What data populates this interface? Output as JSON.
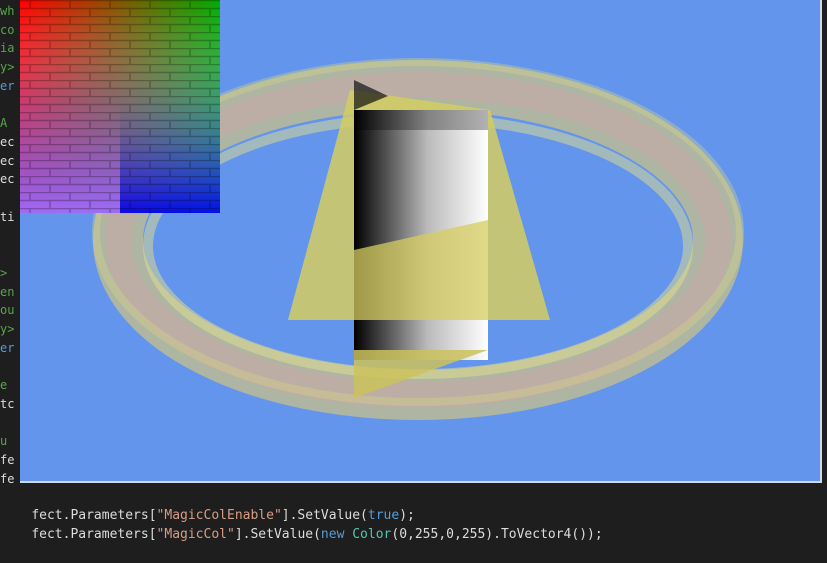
{
  "gutter": {
    "fragments": [
      {
        "text": "wh",
        "color": "#57a64a"
      },
      {
        "text": "co",
        "color": "#57a64a"
      },
      {
        "text": "ia",
        "color": "#57a64a"
      },
      {
        "text": "y>",
        "color": "#57a64a"
      },
      {
        "text": "er",
        "color": "#569cd6"
      },
      {
        "text": "",
        "color": "#dcdcdc"
      },
      {
        "text": " A",
        "color": "#57a64a"
      },
      {
        "text": "ec",
        "color": "#dcdcdc"
      },
      {
        "text": "ec",
        "color": "#dcdcdc"
      },
      {
        "text": "ec",
        "color": "#dcdcdc"
      },
      {
        "text": "",
        "color": "#dcdcdc"
      },
      {
        "text": "ti",
        "color": "#dcdcdc"
      },
      {
        "text": "",
        "color": "#dcdcdc"
      },
      {
        "text": "",
        "color": "#dcdcdc"
      },
      {
        "text": ">",
        "color": "#57a64a"
      },
      {
        "text": "en",
        "color": "#57a64a"
      },
      {
        "text": "ou",
        "color": "#57a64a"
      },
      {
        "text": "y>",
        "color": "#57a64a"
      },
      {
        "text": "er",
        "color": "#569cd6"
      },
      {
        "text": "",
        "color": "#dcdcdc"
      },
      {
        "text": "e",
        "color": "#57a64a"
      },
      {
        "text": "tc",
        "color": "#dcdcdc"
      },
      {
        "text": "",
        "color": "#dcdcdc"
      },
      {
        "text": " u",
        "color": "#57a64a"
      },
      {
        "text": "fe",
        "color": "#dcdcdc"
      },
      {
        "text": "fe",
        "color": "#dcdcdc"
      }
    ]
  },
  "code": {
    "line1": {
      "a": "fect.Parameters[",
      "b": "\"MagicColEnable\"",
      "c": "].SetValue(",
      "d": "true",
      "e": ");"
    },
    "line2": {
      "a": "fect.Parameters[",
      "b": "\"MagicCol\"",
      "c": "].SetValue(",
      "d": "new",
      "e": " ",
      "f": "Color",
      "g": "(0,255,0,255).ToVector4());"
    }
  },
  "scene": {
    "background": "#6495ed",
    "torus_color": "#c8b49a",
    "cone_color": "#d4cc60",
    "cylinder_gradient": [
      "#000000",
      "#ffffff"
    ]
  }
}
